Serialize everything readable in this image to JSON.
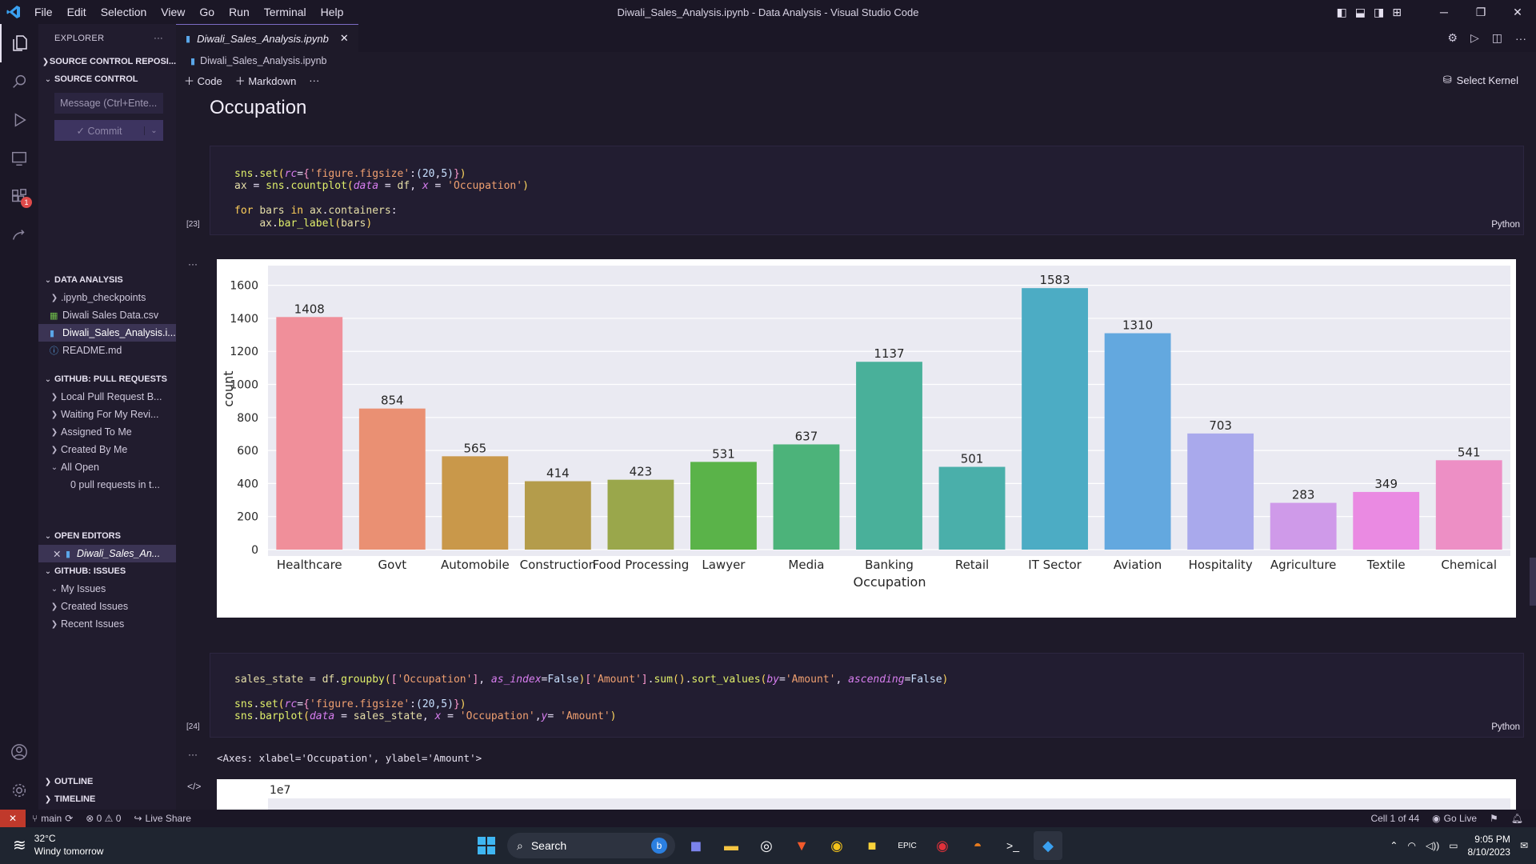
{
  "window": {
    "title": "Diwali_Sales_Analysis.ipynb - Data Analysis - Visual Studio Code",
    "menu": [
      "File",
      "Edit",
      "Selection",
      "View",
      "Go",
      "Run",
      "Terminal",
      "Help"
    ]
  },
  "sidebar": {
    "header": "EXPLORER",
    "sections": {
      "source_control_repos": "SOURCE CONTROL REPOSI...",
      "source_control": "SOURCE CONTROL",
      "data_analysis": "DATA ANALYSIS",
      "pull_requests": "GITHUB: PULL REQUESTS",
      "open_editors": "OPEN EDITORS",
      "issues": "GITHUB: ISSUES",
      "outline": "OUTLINE",
      "timeline": "TIMELINE"
    },
    "commit_message_placeholder": "Message (Ctrl+Ente...",
    "commit_label": "Commit",
    "files": [
      ".ipynb_checkpoints",
      "Diwali Sales Data.csv",
      "Diwali_Sales_Analysis.i...",
      "README.md"
    ],
    "pull_requests": [
      "Local Pull Request B...",
      "Waiting For My Revi...",
      "Assigned To Me",
      "Created By Me",
      "All Open"
    ],
    "pull_requests_empty": "0 pull requests in t...",
    "open_editor_file": "Diwali_Sales_An...",
    "issues": [
      "My Issues",
      "Created Issues",
      "Recent Issues"
    ],
    "extensions_badge": "1"
  },
  "editor": {
    "tab_label": "Diwali_Sales_Analysis.ipynb",
    "breadcrumb": "Diwali_Sales_Analysis.ipynb",
    "toolbar": {
      "code": "Code",
      "markdown": "Markdown",
      "more": "···",
      "kernel": "Select Kernel"
    },
    "markdown_heading": "Occupation",
    "cell1": {
      "exec": "[23]",
      "lang": "Python",
      "lines": [
        "sns.set(rc={'figure.figsize':(20,5)})",
        "ax = sns.countplot(data = df, x = 'Occupation')",
        "",
        "for bars in ax.containers:",
        "    ax.bar_label(bars)"
      ]
    },
    "cell2": {
      "exec": "[24]",
      "lang": "Python",
      "lines": [
        "sales_state = df.groupby(['Occupation'], as_index=False)['Amount'].sum().sort_values(by='Amount', ascending=False)",
        "",
        "sns.set(rc={'figure.figsize':(20,5)})",
        "sns.barplot(data = sales_state, x = 'Occupation',y= 'Amount')"
      ],
      "output_text": "<Axes: xlabel='Occupation', ylabel='Amount'>",
      "next_plot_exponent": "1e7"
    },
    "output_dots": "···"
  },
  "chart_data": {
    "type": "bar",
    "title": "",
    "xlabel": "Occupation",
    "ylabel": "count",
    "ylim": [
      0,
      1700
    ],
    "yticks": [
      0,
      200,
      400,
      600,
      800,
      1000,
      1200,
      1400,
      1600
    ],
    "grid": true,
    "categories": [
      "Healthcare",
      "Govt",
      "Automobile",
      "Construction",
      "Food Processing",
      "Lawyer",
      "Media",
      "Banking",
      "Retail",
      "IT Sector",
      "Aviation",
      "Hospitality",
      "Agriculture",
      "Textile",
      "Chemical"
    ],
    "values": [
      1408,
      854,
      565,
      414,
      423,
      531,
      637,
      1137,
      501,
      1583,
      1310,
      703,
      283,
      349,
      541
    ],
    "colors": [
      "#f08f9a",
      "#ea9073",
      "#c9984a",
      "#b49c4b",
      "#9aa74b",
      "#5ab349",
      "#4cb37a",
      "#49b09a",
      "#4aafaa",
      "#4cacc4",
      "#63a8df",
      "#a9a9ec",
      "#cf9ae9",
      "#ea8ae2",
      "#ed8fc5"
    ]
  },
  "status": {
    "branch": "main",
    "problems": "⊗ 0 ⚠ 0",
    "live_share": "Live Share",
    "cell": "Cell 1 of 44",
    "go_live": "Go Live"
  },
  "taskbar": {
    "temp": "32°C",
    "weather": "Windy tomorrow",
    "search": "Search",
    "time": "9:05 PM",
    "date": "8/10/2023"
  }
}
